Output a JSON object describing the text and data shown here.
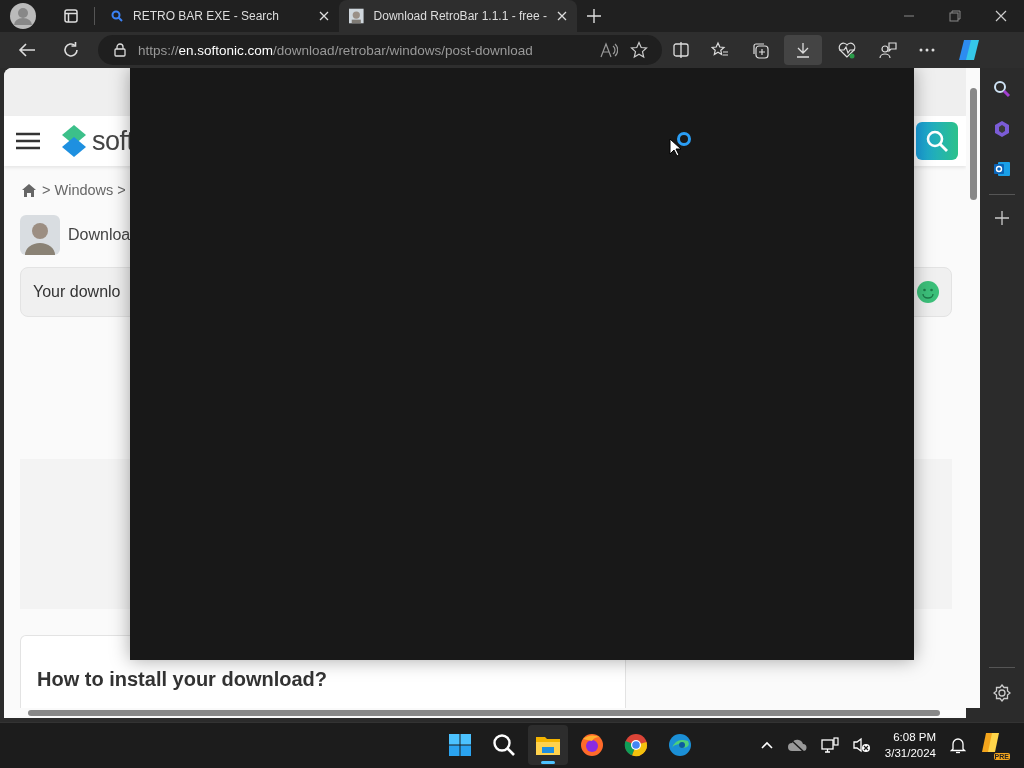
{
  "tabs": [
    {
      "title": "RETRO BAR EXE - Search",
      "selected": false
    },
    {
      "title": "Download RetroBar 1.1.1 - free -",
      "selected": true
    }
  ],
  "address": {
    "scheme": "https://",
    "host": "en.softonic.com",
    "path": "/download/retrobar/windows/post-download"
  },
  "page": {
    "logo": "soft",
    "breadcrumb": [
      "> Windows >"
    ],
    "author": "Downloa",
    "notice": "Your downlo",
    "install_title": "How to install your download?"
  },
  "taskbar": {
    "apps": [
      {
        "kind": "start",
        "selected": false
      },
      {
        "kind": "search",
        "selected": false
      },
      {
        "kind": "files",
        "selected": true
      },
      {
        "kind": "firefox",
        "selected": false
      },
      {
        "kind": "chrome",
        "selected": false
      },
      {
        "kind": "edge",
        "selected": false
      }
    ],
    "time": "6:08 PM",
    "date": "3/31/2024",
    "badge": "PRE"
  }
}
